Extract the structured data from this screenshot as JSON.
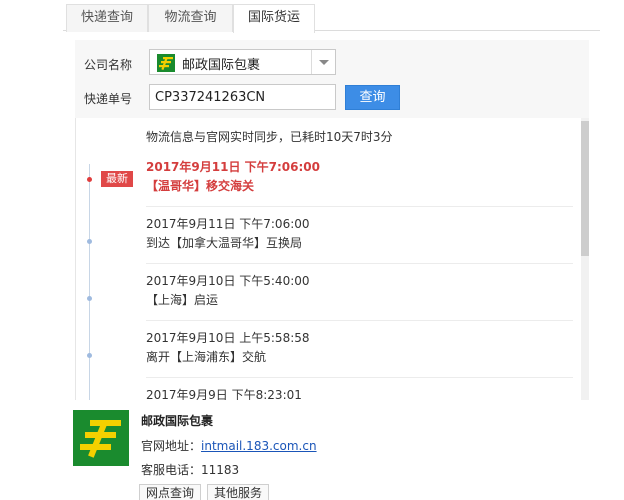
{
  "tabs": [
    {
      "label": "快递查询"
    },
    {
      "label": "物流查询"
    },
    {
      "label": "国际货运"
    }
  ],
  "form": {
    "company_label": "公司名称",
    "company_value": "邮政国际包裹",
    "number_label": "快递单号",
    "number_value": "CP337241263CN",
    "query_button": "查询"
  },
  "results": {
    "sync_text": "物流信息与官网实时同步，已耗时10天7时3分",
    "latest_badge": "最新",
    "events": [
      {
        "time": "2017年9月11日 下午7:06:00",
        "desc": "【温哥华】移交海关"
      },
      {
        "time": "2017年9月11日 下午7:06:00",
        "desc": "到达【加拿大温哥华】互换局"
      },
      {
        "time": "2017年9月10日 下午5:40:00",
        "desc": "【上海】启运"
      },
      {
        "time": "2017年9月10日 上午5:58:58",
        "desc": "离开【上海浦东】交航"
      },
      {
        "time": "2017年9月9日 下午8:23:01",
        "desc": ""
      }
    ]
  },
  "carrier": {
    "name": "邮政国际包裹",
    "site_label": "官网地址：",
    "site_url": "intmail.183.com.cn",
    "phone_label": "客服电话：",
    "phone": "11183",
    "buttons": [
      {
        "label": "网点查询"
      },
      {
        "label": "其他服务"
      }
    ]
  },
  "colors": {
    "accent_blue": "#3d8de6",
    "latest_red": "#d43d3d",
    "logo_green": "#1a8b2e",
    "logo_yellow": "#f4d000"
  },
  "icons": {
    "company_logo": "china-post-logo-icon",
    "dropdown": "chevron-down-icon"
  }
}
